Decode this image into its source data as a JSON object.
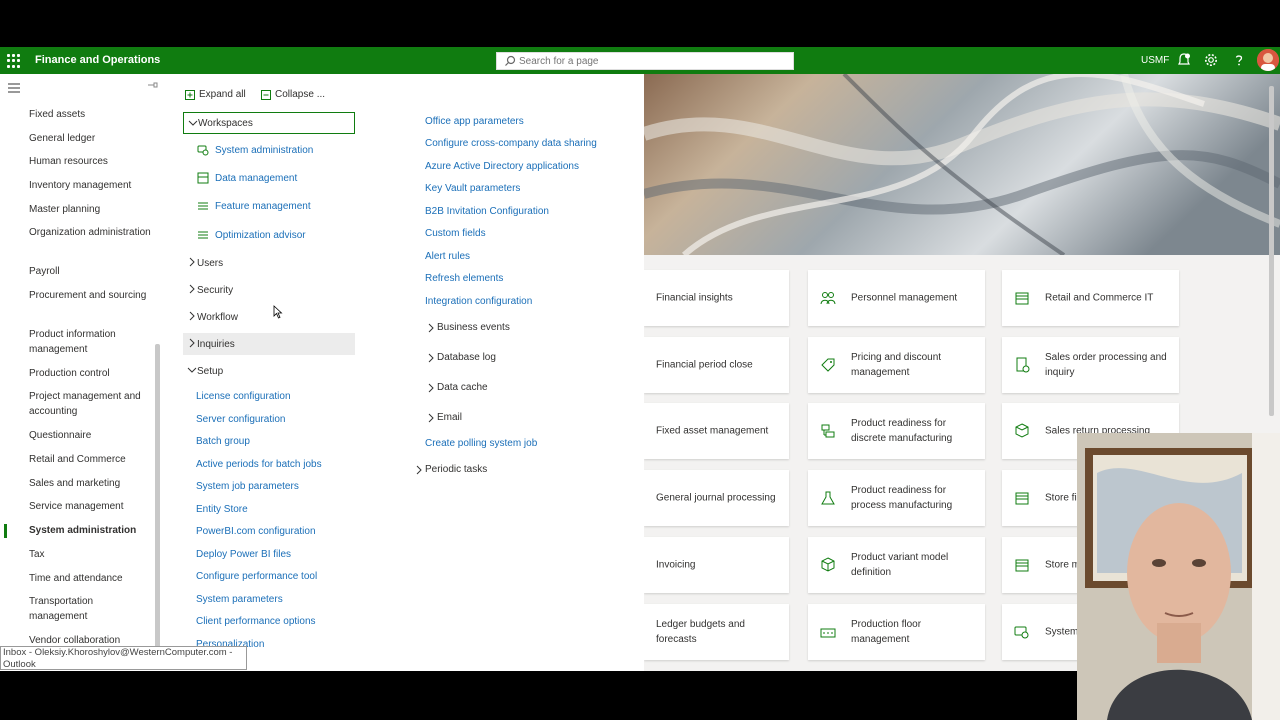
{
  "header": {
    "app_title": "Finance and Operations",
    "search_placeholder": "Search for a page",
    "company": "USMF",
    "colors": {
      "brand": "#107c10",
      "link": "#1b6fb8"
    }
  },
  "leftnav": {
    "items": [
      {
        "label": "Fixed assets"
      },
      {
        "label": "General ledger"
      },
      {
        "label": "Human resources"
      },
      {
        "label": "Inventory management"
      },
      {
        "label": "Master planning"
      },
      {
        "label": "Organization administration"
      },
      {
        "label": "Payroll"
      },
      {
        "label": "Procurement and sourcing"
      },
      {
        "label": "Product information management"
      },
      {
        "label": "Production control"
      },
      {
        "label": "Project management and accounting"
      },
      {
        "label": "Questionnaire"
      },
      {
        "label": "Retail and Commerce"
      },
      {
        "label": "Sales and marketing"
      },
      {
        "label": "Service management"
      },
      {
        "label": "System administration"
      },
      {
        "label": "Tax"
      },
      {
        "label": "Time and attendance"
      },
      {
        "label": "Transportation management"
      },
      {
        "label": "Vendor collaboration"
      }
    ],
    "active_index": 15
  },
  "menu": {
    "expand_all": "Expand all",
    "collapse": "Collapse ...",
    "groups": {
      "workspaces": "Workspaces",
      "users": "Users",
      "security": "Security",
      "workflow": "Workflow",
      "inquiries": "Inquiries",
      "setup": "Setup"
    },
    "workspace_links": [
      {
        "label": "System administration",
        "icon": "workspace-icon"
      },
      {
        "label": "Data management",
        "icon": "data-management-icon"
      },
      {
        "label": "Feature management",
        "icon": "list-icon"
      },
      {
        "label": "Optimization advisor",
        "icon": "list-icon"
      }
    ],
    "setup_links": [
      "License configuration",
      "Server configuration",
      "Batch group",
      "Active periods for batch jobs",
      "System job parameters",
      "Entity Store",
      "PowerBI.com configuration",
      "Deploy Power BI files",
      "Configure performance tool",
      "System parameters",
      "Client performance options",
      "Personalization"
    ],
    "right_links": [
      "Office app parameters",
      "Configure cross-company data sharing",
      "Azure Active Directory applications",
      "Key Vault parameters",
      "B2B Invitation Configuration",
      "Custom fields",
      "Alert rules",
      "Refresh elements",
      "Integration configuration"
    ],
    "sub_groups": [
      "Business events",
      "Database log",
      "Data cache",
      "Email"
    ],
    "polling_link": "Create polling system job",
    "periodic_tasks": "Periodic tasks"
  },
  "tiles": {
    "col1": [
      "Financial insights",
      "Financial period close",
      "Fixed asset management",
      "General journal processing",
      "Invoicing",
      "Ledger budgets and forecasts"
    ],
    "col2": [
      "Personnel management",
      "Pricing and discount management",
      "Product readiness for discrete manufacturing",
      "Product readiness for process manufacturing",
      "Product variant model definition",
      "Production floor management"
    ],
    "col3": [
      "Retail and Commerce IT",
      "Sales order processing and inquiry",
      "Sales return processing",
      "Store fi",
      "Store m",
      "System"
    ]
  },
  "tooltip": "Inbox - Oleksiy.Khoroshylov@WesternComputer.com - Outlook"
}
